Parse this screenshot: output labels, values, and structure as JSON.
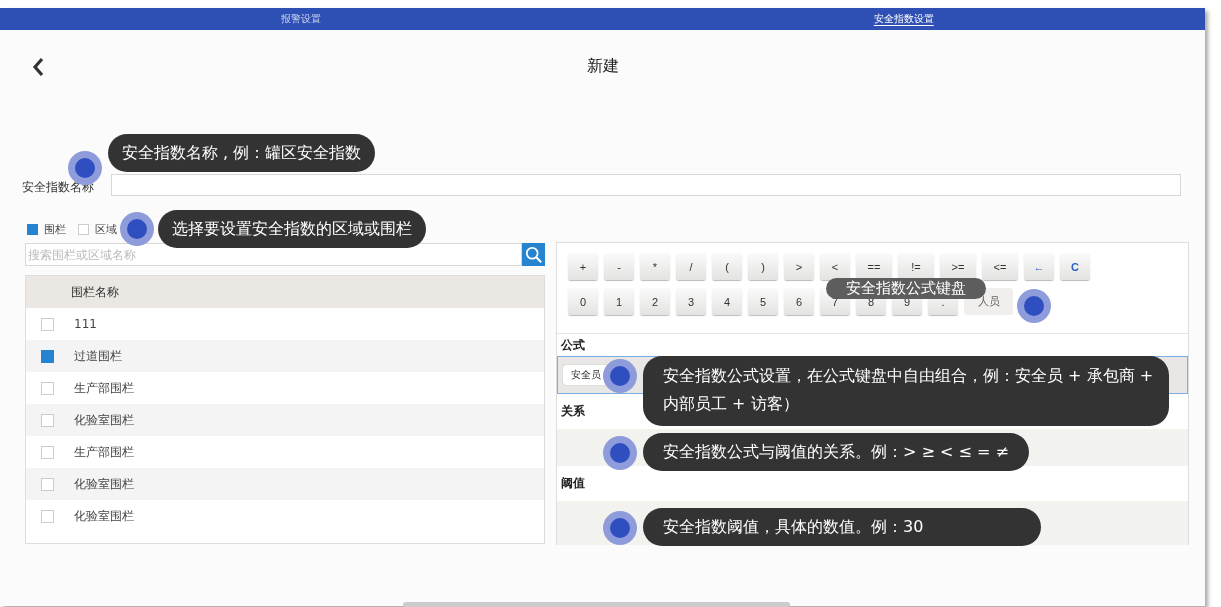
{
  "tabs": [
    {
      "label": "报警设置",
      "selected": false
    },
    {
      "label": "安全指数设置",
      "selected": true
    }
  ],
  "header": {
    "title": "新建"
  },
  "name_field": {
    "label": "安全指数名称",
    "hint": "安全指数名称 , 例：罐区安全指数"
  },
  "scope": {
    "options": [
      {
        "label": "围栏",
        "selected": true
      },
      {
        "label": "区域",
        "selected": false
      }
    ],
    "hint": "选择要设置安全指数的区域或围栏"
  },
  "search": {
    "placeholder": "搜索围栏或区域名称"
  },
  "table": {
    "columns": [
      "围栏名称"
    ],
    "rows": [
      {
        "name": "111",
        "checked": false
      },
      {
        "name": "过道围栏",
        "checked": true
      },
      {
        "name": "生产部围栏",
        "checked": false
      },
      {
        "name": "化验室围栏",
        "checked": false
      },
      {
        "name": "生产部围栏",
        "checked": false
      },
      {
        "name": "化验室围栏",
        "checked": false
      },
      {
        "name": "化验室围栏",
        "checked": false
      }
    ]
  },
  "keypad": {
    "hint": "安全指数公式键盘",
    "rows": [
      [
        {
          "label": "+",
          "kind": "key"
        },
        {
          "label": "-",
          "kind": "key"
        },
        {
          "label": "*",
          "kind": "key"
        },
        {
          "label": "/",
          "kind": "key"
        },
        {
          "label": "(",
          "kind": "key"
        },
        {
          "label": ")",
          "kind": "key"
        },
        {
          "label": ">",
          "kind": "key"
        },
        {
          "label": "<",
          "kind": "key"
        },
        {
          "label": "==",
          "kind": "key"
        },
        {
          "label": "!=",
          "kind": "key"
        },
        {
          "label": ">=",
          "kind": "key"
        },
        {
          "label": "<=",
          "kind": "key"
        },
        {
          "label": "←",
          "kind": "action"
        },
        {
          "label": "C",
          "kind": "action"
        }
      ],
      [
        {
          "label": "0",
          "kind": "key"
        },
        {
          "label": "1",
          "kind": "key"
        },
        {
          "label": "2",
          "kind": "key"
        },
        {
          "label": "3",
          "kind": "key"
        },
        {
          "label": "4",
          "kind": "key"
        },
        {
          "label": "5",
          "kind": "key"
        },
        {
          "label": "6",
          "kind": "key"
        },
        {
          "label": "7",
          "kind": "key"
        },
        {
          "label": "8",
          "kind": "key"
        },
        {
          "label": "9",
          "kind": "key"
        },
        {
          "label": ".",
          "kind": "key"
        },
        {
          "label": "人员",
          "kind": "wide"
        }
      ]
    ]
  },
  "formula": {
    "label": "公式",
    "tokens": [
      "安全员"
    ],
    "hint": "安全指数公式设置，在公式键盘中自由组合，例：安全员 + 承包商 + 内部员工 + 访客）"
  },
  "relation": {
    "label": "关系",
    "hint": "安全指数公式与阈值的关系。例：> ≥ < ≤ = ≠"
  },
  "threshold": {
    "label": "阈值",
    "hint": "安全指数阈值，具体的数值。例：30"
  }
}
